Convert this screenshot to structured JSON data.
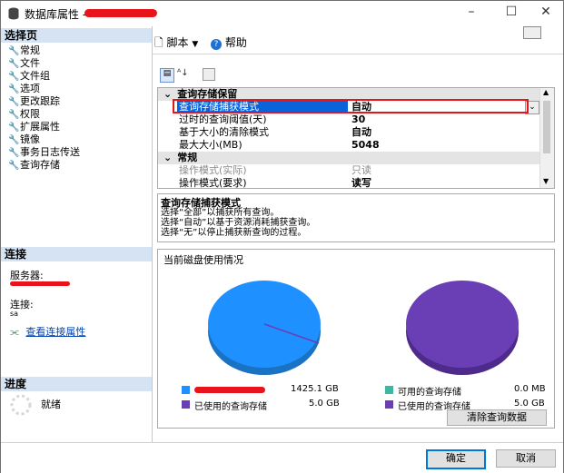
{
  "window": {
    "title": "数据库属性 -",
    "min": "–",
    "max": "☐",
    "close": "✕"
  },
  "sidebar": {
    "select_page_header": "选择页",
    "pages": [
      {
        "label": "常规"
      },
      {
        "label": "文件"
      },
      {
        "label": "文件组"
      },
      {
        "label": "选项"
      },
      {
        "label": "更改跟踪"
      },
      {
        "label": "权限"
      },
      {
        "label": "扩展属性"
      },
      {
        "label": "镜像"
      },
      {
        "label": "事务日志传送"
      },
      {
        "label": "查询存储"
      }
    ],
    "connection_header": "连接",
    "server_label": "服务器:",
    "connection_label": "连接:",
    "connection_value": "sa",
    "view_connection_link": "查看连接属性",
    "progress_header": "进度",
    "progress_status": "就绪"
  },
  "toolbar": {
    "script_label": "脚本",
    "help_label": "帮助"
  },
  "grid": {
    "category1": "查询存储保留",
    "rows1": [
      {
        "name": "查询存储捕获模式",
        "value": "自动",
        "selected": true
      },
      {
        "name": "过时的查询阈值(天)",
        "value": "30"
      },
      {
        "name": "基于大小的清除模式",
        "value": "自动"
      },
      {
        "name": "最大大小(MB)",
        "value": "5048"
      }
    ],
    "category2": "常规",
    "rows2": [
      {
        "name": "操作模式(实际)",
        "value": "只读",
        "disabled": true
      },
      {
        "name": "操作模式(要求)",
        "value": "读写"
      }
    ]
  },
  "description": {
    "title": "查询存储捕获模式",
    "lines": [
      "选择“全部”以捕获所有查询。",
      "选择“自动”以基于资源消耗捕获查询。",
      "选择“无”以停止捕获新查询的过程。"
    ]
  },
  "usage": {
    "header": "当前磁盘使用情况",
    "left_legend": [
      {
        "label": "",
        "value": "1425.1 GB",
        "color": "#1e90ff"
      },
      {
        "label": "已使用的查询存储",
        "value": "5.0 GB",
        "color": "#6a3fb5"
      }
    ],
    "right_legend": [
      {
        "label": "可用的查询存储",
        "value": "0.0 MB",
        "color": "#3cb9a0"
      },
      {
        "label": "已使用的查询存储",
        "value": "5.0 GB",
        "color": "#6a3fb5"
      }
    ],
    "purge_button": "清除查询数据"
  },
  "footer": {
    "ok": "确定",
    "cancel": "取消"
  },
  "colors": {
    "accent": "#0078d7",
    "selection": "#0a63d8",
    "highlight_red": "#e8141b",
    "header_bg": "#d6e3f3"
  }
}
